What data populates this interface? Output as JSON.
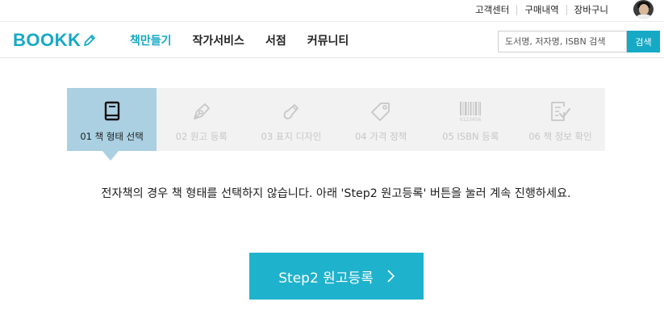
{
  "util_bar": {
    "links": [
      "고객센터",
      "구매내역",
      "장바구니"
    ]
  },
  "header": {
    "logo": "BOOKK",
    "nav": [
      "책만들기",
      "작가서비스",
      "서점",
      "커뮤니티"
    ],
    "search_placeholder": "도서명, 저자명, ISBN 검색",
    "search_button": "검색"
  },
  "steps": [
    {
      "label": "01 책 형태 선택",
      "icon": "book-icon",
      "active": true
    },
    {
      "label": "02 원고 등록",
      "icon": "pen-nib-icon",
      "active": false
    },
    {
      "label": "03 표지 디자인",
      "icon": "brush-icon",
      "active": false
    },
    {
      "label": "04 가격 정책",
      "icon": "price-tag-icon",
      "active": false
    },
    {
      "label": "05 ISBN 등록",
      "icon": "barcode-icon",
      "active": false
    },
    {
      "label": "06 책 정보 확인",
      "icon": "checklist-icon",
      "active": false
    }
  ],
  "barcode_digits": "0123456",
  "notice": "전자책의 경우 책 형태를 선택하지 않습니다. 아래 'Step2 원고등록' 버튼을 눌러 계속 진행하세요.",
  "next_button": "Step2 원고등록",
  "colors": {
    "brand": "#16a9c6",
    "active_step": "#aad0e2",
    "step_bar": "#f2f2f2",
    "inactive_icon": "#c7c7c7"
  }
}
